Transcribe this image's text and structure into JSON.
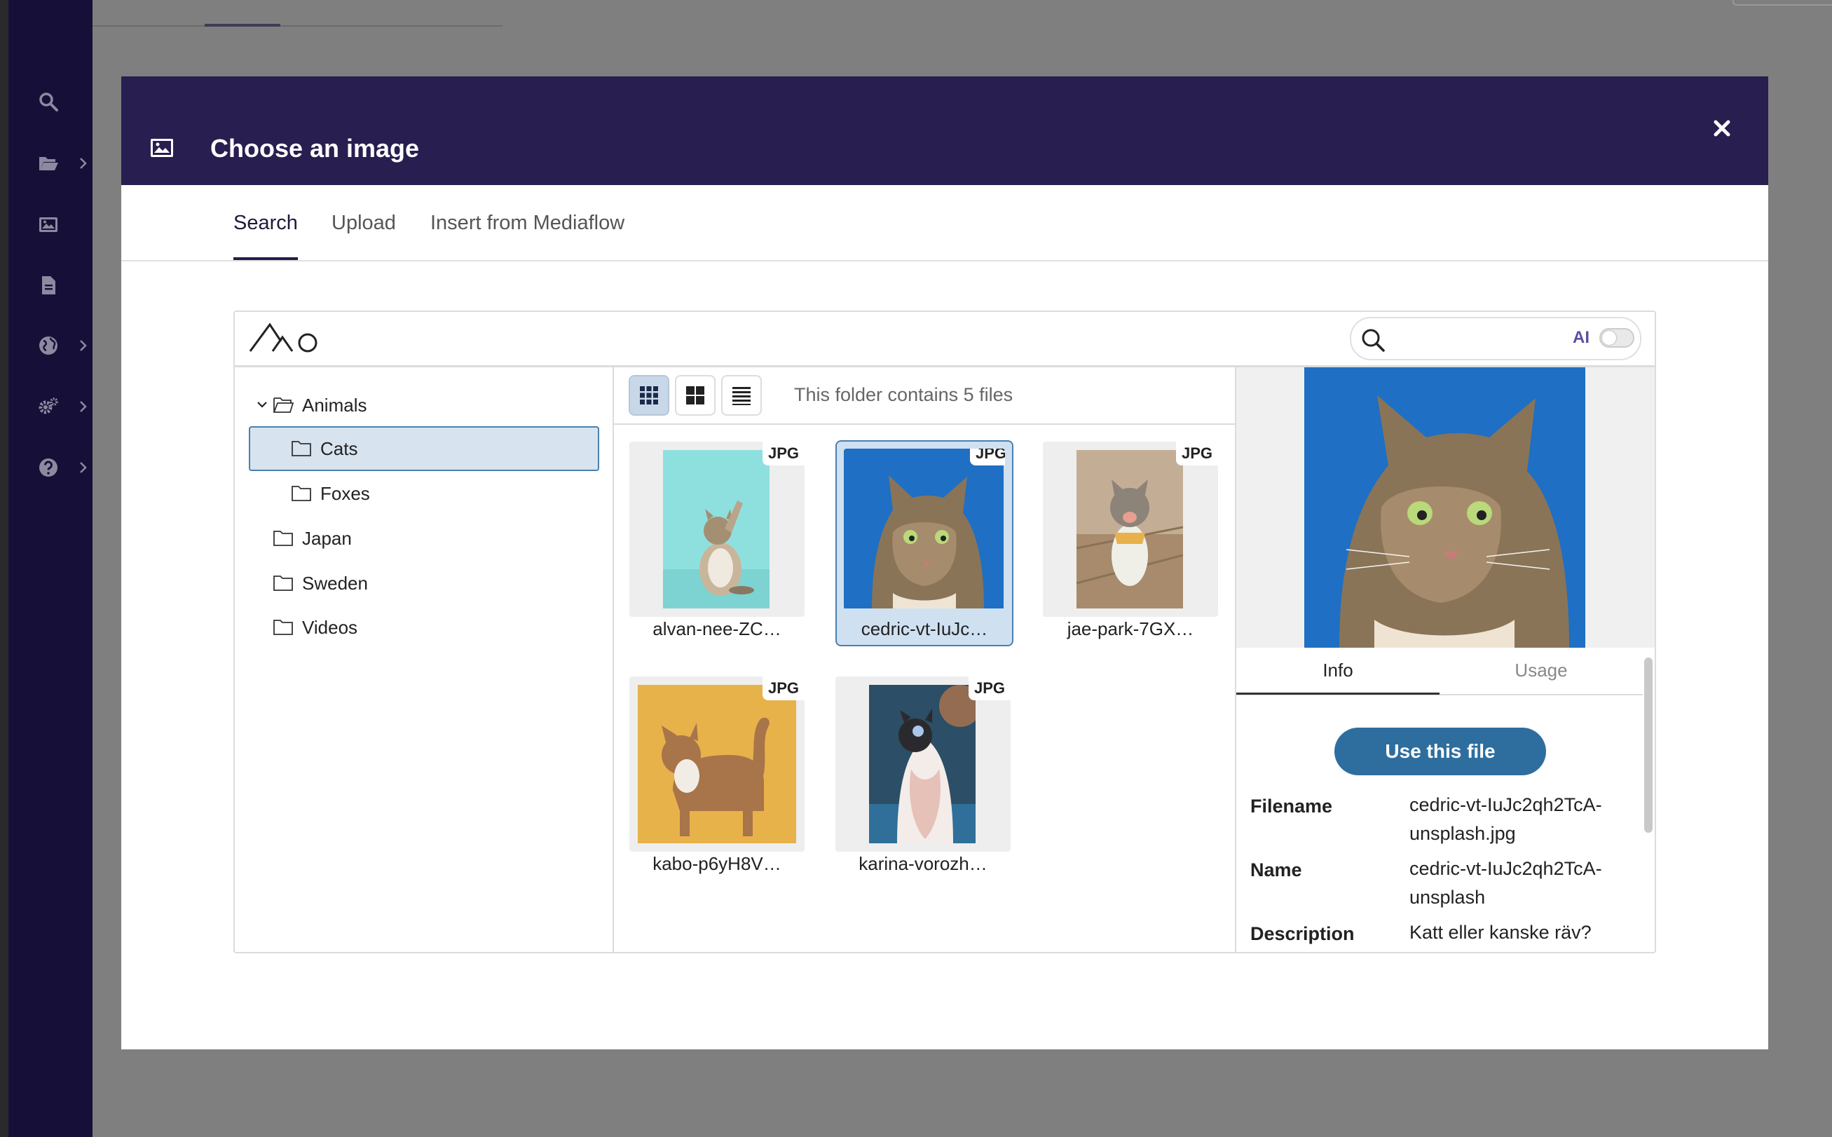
{
  "modal": {
    "title": "Choose an image",
    "tabs": [
      "Search",
      "Upload",
      "Insert from Mediaflow"
    ]
  },
  "search": {
    "placeholder": "",
    "ai_label": "AI"
  },
  "folders": [
    {
      "label": "Animals",
      "level": 0,
      "expanded": true
    },
    {
      "label": "Cats",
      "level": 1,
      "selected": true
    },
    {
      "label": "Foxes",
      "level": 1
    },
    {
      "label": "Japan",
      "level": 0
    },
    {
      "label": "Sweden",
      "level": 0
    },
    {
      "label": "Videos",
      "level": 0
    }
  ],
  "grid": {
    "folder_info": "This folder contains 5 files",
    "files": [
      {
        "name": "alvan-nee-ZC…",
        "type": "JPG",
        "bg": "#8ee0e0"
      },
      {
        "name": "cedric-vt-IuJc…",
        "type": "JPG",
        "bg": "#1f6fc4",
        "selected": true
      },
      {
        "name": "jae-park-7GX…",
        "type": "JPG",
        "bg": "#b7a08a"
      },
      {
        "name": "kabo-p6yH8V…",
        "type": "JPG",
        "bg": "#e7b24a"
      },
      {
        "name": "karina-vorozh…",
        "type": "JPG",
        "bg": "#2c4e66"
      }
    ]
  },
  "info": {
    "tabs": [
      "Info",
      "Usage"
    ],
    "use_button": "Use this file",
    "meta": [
      {
        "key": "Filename",
        "value": "cedric-vt-IuJc2qh2TcA-unsplash.jpg"
      },
      {
        "key": "Name",
        "value": "cedric-vt-IuJc2qh2TcA-unsplash"
      },
      {
        "key": "Description",
        "value": "Katt eller kanske räv?"
      }
    ]
  },
  "colors": {
    "header": "#281e50",
    "sidebar": "#161038",
    "accent": "#2e6e9e",
    "selection": "#d7e3ef"
  }
}
